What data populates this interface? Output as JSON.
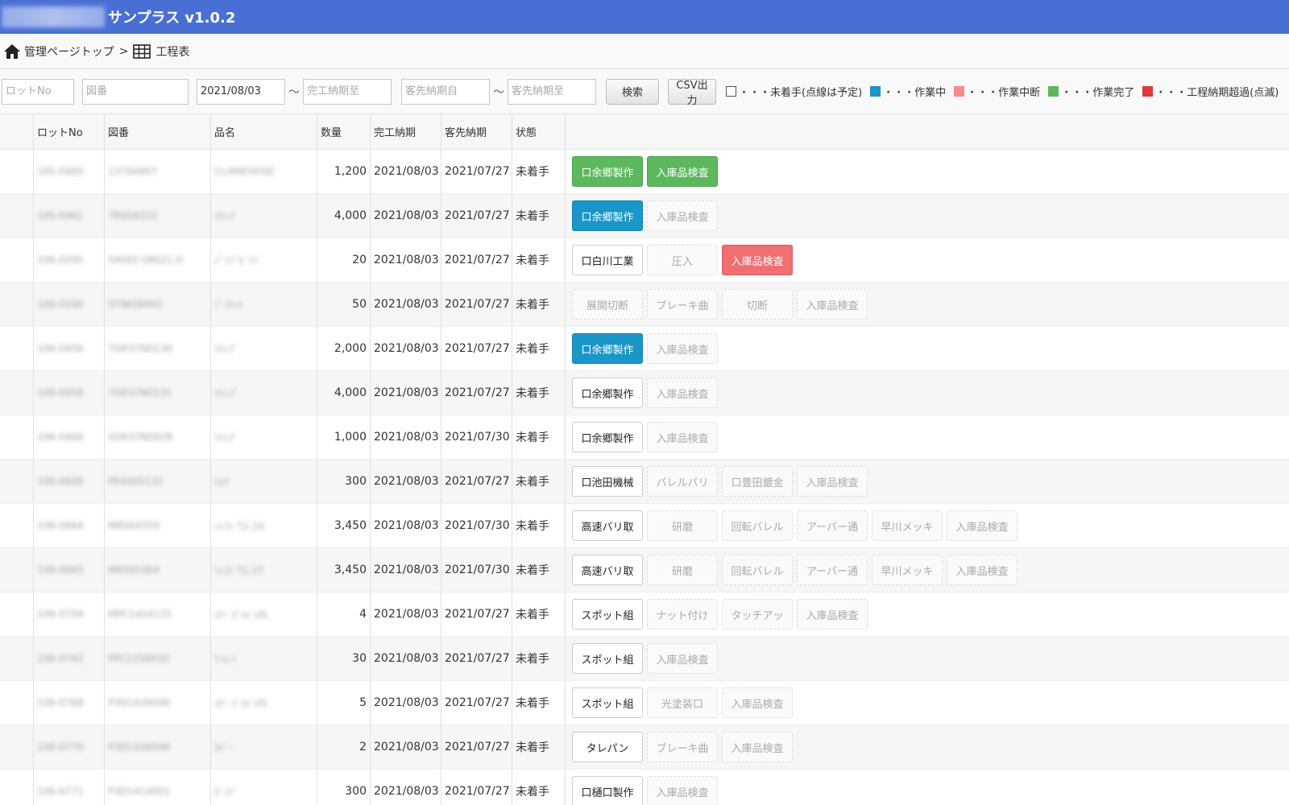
{
  "header": {
    "title": "サンプラス v1.0.2"
  },
  "breadcrumb": {
    "home_label": "管理ページトップ",
    "separator": ">",
    "current_label": "工程表"
  },
  "search": {
    "lot_placeholder": "ロットNo",
    "drawing_placeholder": "図番",
    "complete_from_value": "2021/08/03",
    "tilde": "〜",
    "complete_to_placeholder": "完工納期至",
    "customer_from_placeholder": "客先納期自",
    "customer_to_placeholder": "客先納期至",
    "search_label": "検索",
    "csv_label": "CSV出力"
  },
  "legend": [
    {
      "label": "・・・未着手(点線は予定)",
      "color": "#ffffff"
    },
    {
      "label": "・・・作業中",
      "color": "#1a96c8"
    },
    {
      "label": "・・・作業中断",
      "color": "#f78b8d"
    },
    {
      "label": "・・・作業完了",
      "color": "#5cb85c"
    },
    {
      "label": "・・・工程納期超過(点滅)",
      "color": "#e0383b"
    }
  ],
  "colors": {
    "header": "#4a6fd4",
    "in_progress": "#1a96c8",
    "paused": "#ef6f72",
    "done": "#5cb85c",
    "overdue": "#e0383b"
  },
  "table": {
    "columns": [
      "",
      "ロットNo",
      "図番",
      "品名",
      "数量",
      "完工納期",
      "客先納期",
      "状態"
    ],
    "rows": [
      {
        "lot": "105-0460",
        "drawing": "1370A807",
        "name": "CLAMEHOSE",
        "qty": "1,200",
        "done": "2021/08/03",
        "cust": "2021/07/27",
        "status": "未着手",
        "procs": [
          {
            "label": "口余郷製作",
            "state": "green"
          },
          {
            "label": "入庫品検査",
            "state": "green"
          }
        ]
      },
      {
        "lot": "105-0461",
        "drawing": "7R0S8322",
        "name": "ｸﾘｯﾌﾟ",
        "qty": "4,000",
        "done": "2021/08/03",
        "cust": "2021/07/27",
        "status": "未着手",
        "procs": [
          {
            "label": "口余郷製作",
            "state": "blue"
          },
          {
            "label": "入庫品検査",
            "state": "idle"
          }
        ]
      },
      {
        "lot": "106-0295",
        "drawing": "54002-08021-0",
        "name": "ﾊﾟｲﾌﾟｶﾞｲﾄﾞ",
        "qty": "20",
        "done": "2021/08/03",
        "cust": "2021/07/27",
        "status": "未着手",
        "procs": [
          {
            "label": "口白川工業",
            "state": "active"
          },
          {
            "label": "圧入",
            "state": "idle"
          },
          {
            "label": "入庫品検査",
            "state": "red"
          }
        ]
      },
      {
        "lot": "106-0296",
        "drawing": "ST9658402",
        "name": "ﾌﾞﾗｹｯﾄ",
        "qty": "50",
        "done": "2021/08/03",
        "cust": "2021/07/27",
        "status": "未着手",
        "procs": [
          {
            "label": "展開切断",
            "state": "idle"
          },
          {
            "label": "ブレーキ曲",
            "state": "idle"
          },
          {
            "label": "切断",
            "state": "idle"
          },
          {
            "label": "入庫品検査",
            "state": "idle"
          }
        ]
      },
      {
        "lot": "106-0456",
        "drawing": "7GR37N0130",
        "name": "ｸﾘｯﾌﾟ",
        "qty": "2,000",
        "done": "2021/08/03",
        "cust": "2021/07/27",
        "status": "未着手",
        "procs": [
          {
            "label": "口余郷製作",
            "state": "blue"
          },
          {
            "label": "入庫品検査",
            "state": "idle"
          }
        ]
      },
      {
        "lot": "106-0458",
        "drawing": "7GR37N0131",
        "name": "ｸﾘｯﾌﾟ",
        "qty": "4,000",
        "done": "2021/08/03",
        "cust": "2021/07/27",
        "status": "未着手",
        "procs": [
          {
            "label": "口余郷製作",
            "state": "active"
          },
          {
            "label": "入庫品検査",
            "state": "idle"
          }
        ]
      },
      {
        "lot": "106-0466",
        "drawing": "5GR37N0028",
        "name": "ｸﾘｯﾌﾟ",
        "qty": "1,000",
        "done": "2021/08/03",
        "cust": "2021/07/30",
        "status": "未着手",
        "procs": [
          {
            "label": "口余郷製作",
            "state": "active"
          },
          {
            "label": "入庫品検査",
            "state": "idle"
          }
        ]
      },
      {
        "lot": "106-0608",
        "drawing": "PR4005131",
        "name": "ﾄﾙｸ",
        "qty": "300",
        "done": "2021/08/03",
        "cust": "2021/07/27",
        "status": "未着手",
        "procs": [
          {
            "label": "口池田機械",
            "state": "active"
          },
          {
            "label": "バレルバリ",
            "state": "idle"
          },
          {
            "label": "口豊田鍍金",
            "state": "idle"
          },
          {
            "label": "入庫品検査",
            "state": "idle"
          }
        ]
      },
      {
        "lot": "106-0664",
        "drawing": "M8564359",
        "name": "ｼｬﾌﾄ T2.24",
        "qty": "3,450",
        "done": "2021/08/03",
        "cust": "2021/07/30",
        "status": "未着手",
        "procs": [
          {
            "label": "高速バリ取",
            "state": "active"
          },
          {
            "label": "研磨",
            "state": "idle"
          },
          {
            "label": "回転バレル",
            "state": "idle"
          },
          {
            "label": "アーバー通",
            "state": "idle"
          },
          {
            "label": "早川メッキ",
            "state": "idle"
          },
          {
            "label": "入庫品検査",
            "state": "idle"
          }
        ]
      },
      {
        "lot": "106-0665",
        "drawing": "M8565364",
        "name": "ｼｬﾌﾄ T2.27",
        "qty": "3,450",
        "done": "2021/08/03",
        "cust": "2021/07/30",
        "status": "未着手",
        "procs": [
          {
            "label": "高速バリ取",
            "state": "active"
          },
          {
            "label": "研磨",
            "state": "idle"
          },
          {
            "label": "回転バレル",
            "state": "idle"
          },
          {
            "label": "アーバー通",
            "state": "idle"
          },
          {
            "label": "早川メッキ",
            "state": "idle"
          },
          {
            "label": "入庫品検査",
            "state": "idle"
          }
        ]
      },
      {
        "lot": "106-0759",
        "drawing": "MPC1424125",
        "name": "ｽﾃｰ ﾎﾞﾙﾄ VS",
        "qty": "4",
        "done": "2021/08/03",
        "cust": "2021/07/27",
        "status": "未着手",
        "procs": [
          {
            "label": "スポット組",
            "state": "active"
          },
          {
            "label": "ナット付け",
            "state": "idle"
          },
          {
            "label": "タッチアッ",
            "state": "idle"
          },
          {
            "label": "入庫品検査",
            "state": "idle"
          }
        ]
      },
      {
        "lot": "106-0762",
        "drawing": "PPC1256032",
        "name": "ｱｰﾑ ﾄ",
        "qty": "30",
        "done": "2021/08/03",
        "cust": "2021/07/27",
        "status": "未着手",
        "procs": [
          {
            "label": "スポット組",
            "state": "active"
          },
          {
            "label": "入庫品検査",
            "state": "idle"
          }
        ]
      },
      {
        "lot": "106-0768",
        "drawing": "P3D1426040",
        "name": "ｽﾃｰ ﾎﾞﾙﾄ VS",
        "qty": "5",
        "done": "2021/08/03",
        "cust": "2021/07/27",
        "status": "未着手",
        "procs": [
          {
            "label": "スポット組",
            "state": "active"
          },
          {
            "label": "光塗装口",
            "state": "idle"
          },
          {
            "label": "入庫品検査",
            "state": "idle"
          }
        ]
      },
      {
        "lot": "106-0770",
        "drawing": "P3D1426046",
        "name": "ｶﾊﾞｰ",
        "qty": "2",
        "done": "2021/08/03",
        "cust": "2021/07/27",
        "status": "未着手",
        "procs": [
          {
            "label": "タレパン",
            "state": "active"
          },
          {
            "label": "ブレーキ曲",
            "state": "idle"
          },
          {
            "label": "入庫品検査",
            "state": "idle"
          }
        ]
      },
      {
        "lot": "106-0771",
        "drawing": "P3D1414001",
        "name": "ｶﾞｲﾄﾞ",
        "qty": "300",
        "done": "2021/08/03",
        "cust": "2021/07/27",
        "status": "未着手",
        "procs": [
          {
            "label": "口樋口製作",
            "state": "active"
          },
          {
            "label": "入庫品検査",
            "state": "idle"
          }
        ]
      }
    ]
  }
}
